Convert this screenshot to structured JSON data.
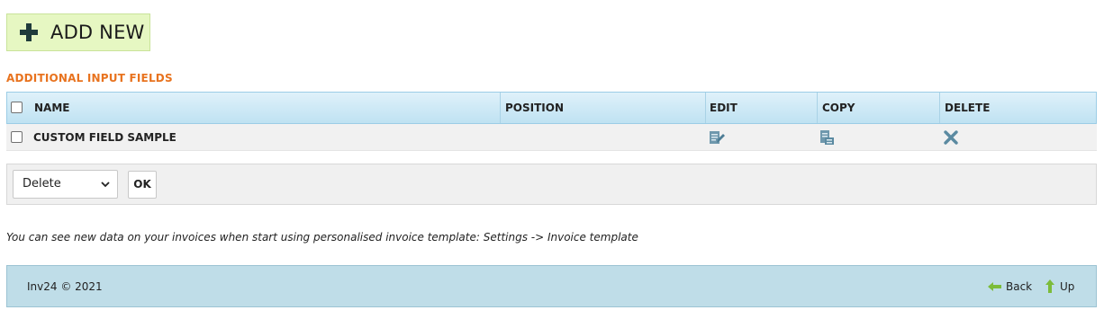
{
  "toolbar": {
    "add_new_label": "ADD NEW"
  },
  "section": {
    "title": "ADDITIONAL INPUT FIELDS"
  },
  "table": {
    "headers": {
      "name": "NAME",
      "position": "POSITION",
      "edit": "EDIT",
      "copy": "COPY",
      "delete": "DELETE"
    },
    "rows": [
      {
        "name": "CUSTOM FIELD SAMPLE",
        "position": "",
        "edit_icon": "edit-icon",
        "copy_icon": "copy-icon",
        "delete_icon": "delete-icon"
      }
    ]
  },
  "bulk_actions": {
    "selected": "Delete",
    "ok_label": "OK"
  },
  "note": "You can see new data on your invoices when start using personalised invoice template: Settings -> Invoice template",
  "footer": {
    "copyright": "Inv24 © 2021",
    "back_label": "Back",
    "up_label": "Up"
  },
  "colors": {
    "accent_orange": "#e8731f",
    "add_button_bg": "#e6f7c2",
    "header_bg": "#bfe2f2",
    "footer_bg": "#bfdde8"
  }
}
